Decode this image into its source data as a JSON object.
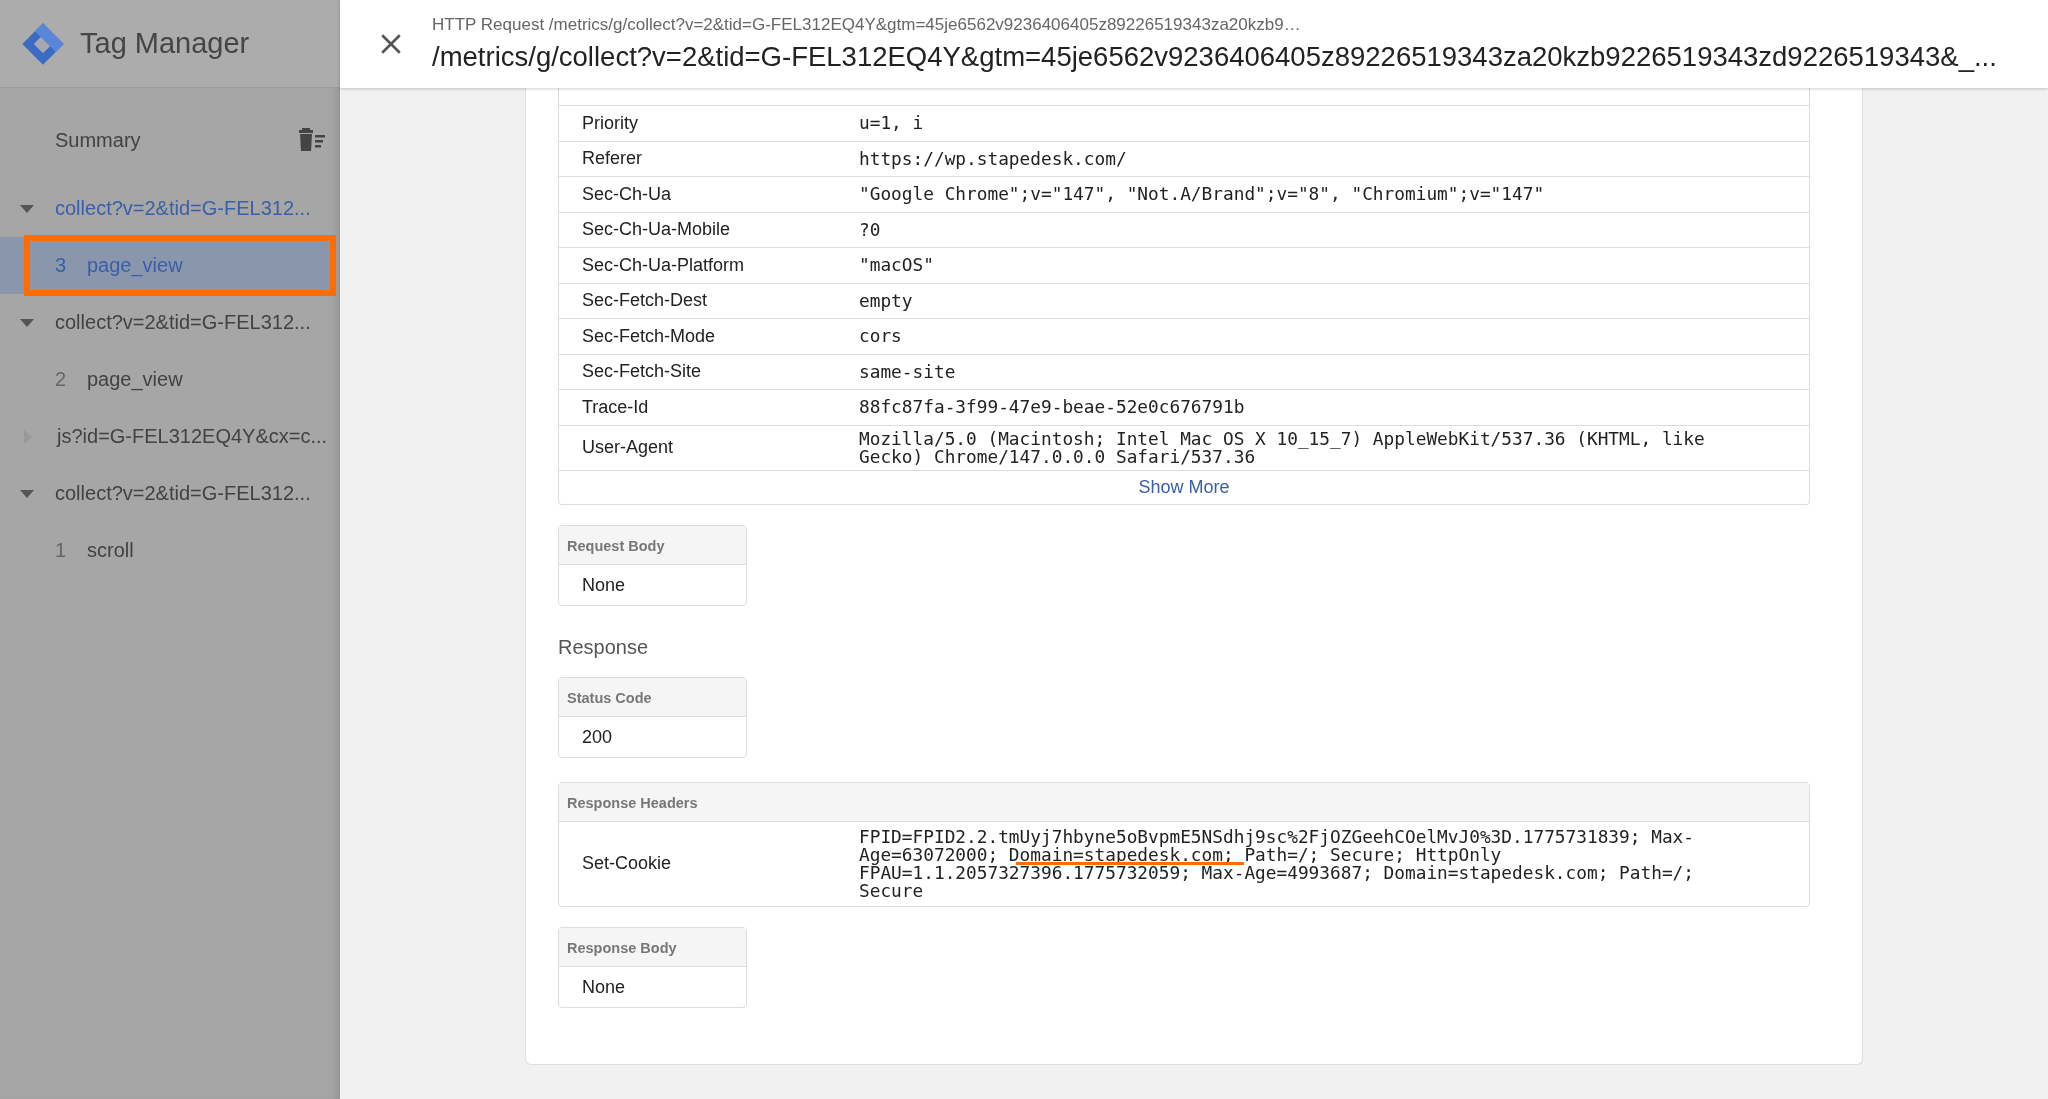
{
  "app": {
    "title": "Tag Manager"
  },
  "sidebar": {
    "summary": "Summary",
    "groups": [
      {
        "label": "collect?v=2&tid=G-FEL312...",
        "expanded": true,
        "active": true,
        "children": [
          {
            "number": "3",
            "label": "page_view",
            "selected": true,
            "annotated": true
          }
        ]
      },
      {
        "label": "collect?v=2&tid=G-FEL312...",
        "expanded": true,
        "active": false,
        "children": [
          {
            "number": "2",
            "label": "page_view",
            "selected": false,
            "annotated": false
          }
        ]
      },
      {
        "label": "js?id=G-FEL312EQ4Y&cx=c...",
        "expanded": false,
        "active": false
      },
      {
        "label": "collect?v=2&tid=G-FEL312...",
        "expanded": true,
        "active": false,
        "children": [
          {
            "number": "1",
            "label": "scroll",
            "selected": false,
            "annotated": false
          }
        ]
      }
    ]
  },
  "dialog": {
    "subtitle": "HTTP Request /metrics/g/collect?v=2&tid=G-FEL312EQ4Y&gtm=45je6562v9236406405z89226519343za20kzb9…",
    "title": "/metrics/g/collect?v=2&tid=G-FEL312EQ4Y&gtm=45je6562v9236406405z89226519343za20kzb9226519343zd9226519343&_...",
    "request_headers": [
      {
        "name": "Priority",
        "value": "u=1, i"
      },
      {
        "name": "Referer",
        "value": "https://wp.stapedesk.com/"
      },
      {
        "name": "Sec-Ch-Ua",
        "value": "\"Google Chrome\";v=\"147\", \"Not.A/Brand\";v=\"8\", \"Chromium\";v=\"147\""
      },
      {
        "name": "Sec-Ch-Ua-Mobile",
        "value": "?0"
      },
      {
        "name": "Sec-Ch-Ua-Platform",
        "value": "\"macOS\""
      },
      {
        "name": "Sec-Fetch-Dest",
        "value": "empty"
      },
      {
        "name": "Sec-Fetch-Mode",
        "value": "cors"
      },
      {
        "name": "Sec-Fetch-Site",
        "value": "same-site"
      },
      {
        "name": "Trace-Id",
        "value": "88fc87fa-3f99-47e9-beae-52e0c676791b"
      },
      {
        "name": "User-Agent",
        "value": "Mozilla/5.0 (Macintosh; Intel Mac OS X 10_15_7) AppleWebKit/537.36 (KHTML, like Gecko) Chrome/147.0.0.0 Safari/537.36"
      }
    ],
    "show_more": "Show More",
    "request_body": {
      "label": "Request Body",
      "value": "None"
    },
    "response_heading": "Response",
    "status_code": {
      "label": "Status Code",
      "value": "200"
    },
    "response_headers": {
      "label": "Response Headers",
      "rows": [
        {
          "name": "Set-Cookie",
          "value": "FPID=FPID2.2.tmUyj7hbyne5oBvpmE5NSdhj9sc%2FjOZGeehCOelMvJ0%3D.1775731839; Max-Age=63072000; Domain=stapedesk.com; Path=/; Secure; HttpOnly FPAU=1.1.2057327396.1775732059; Max-Age=4993687; Domain=stapedesk.com; Path=/; Secure",
          "annotated": true
        }
      ]
    },
    "response_body": {
      "label": "Response Body",
      "value": "None"
    }
  }
}
